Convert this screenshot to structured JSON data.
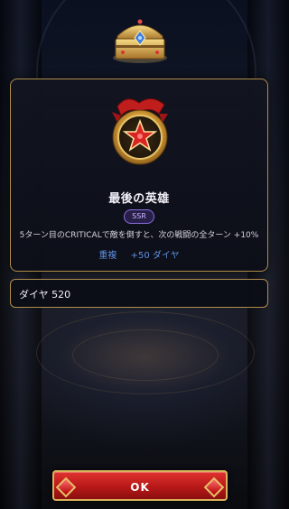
{
  "reward": {
    "name": "最後の英雄",
    "rarity": "SSR",
    "description": "5ターン目のCRITICALで敵を倒すと、次の戦闘の全ターン +10%",
    "duplicate_label": "重複",
    "duplicate_bonus": "+50 ダイヤ"
  },
  "currency": {
    "text": "ダイヤ 520"
  },
  "buttons": {
    "ok_label": "OK"
  },
  "icons": {
    "chest": "treasure-chest-icon",
    "medal": "star-medal-icon"
  },
  "colors": {
    "panel_border": "#b08d4a",
    "rarity": "#8c6de0",
    "duplicate_text": "#5e8fe0",
    "ok_button": "#c41f1f"
  }
}
